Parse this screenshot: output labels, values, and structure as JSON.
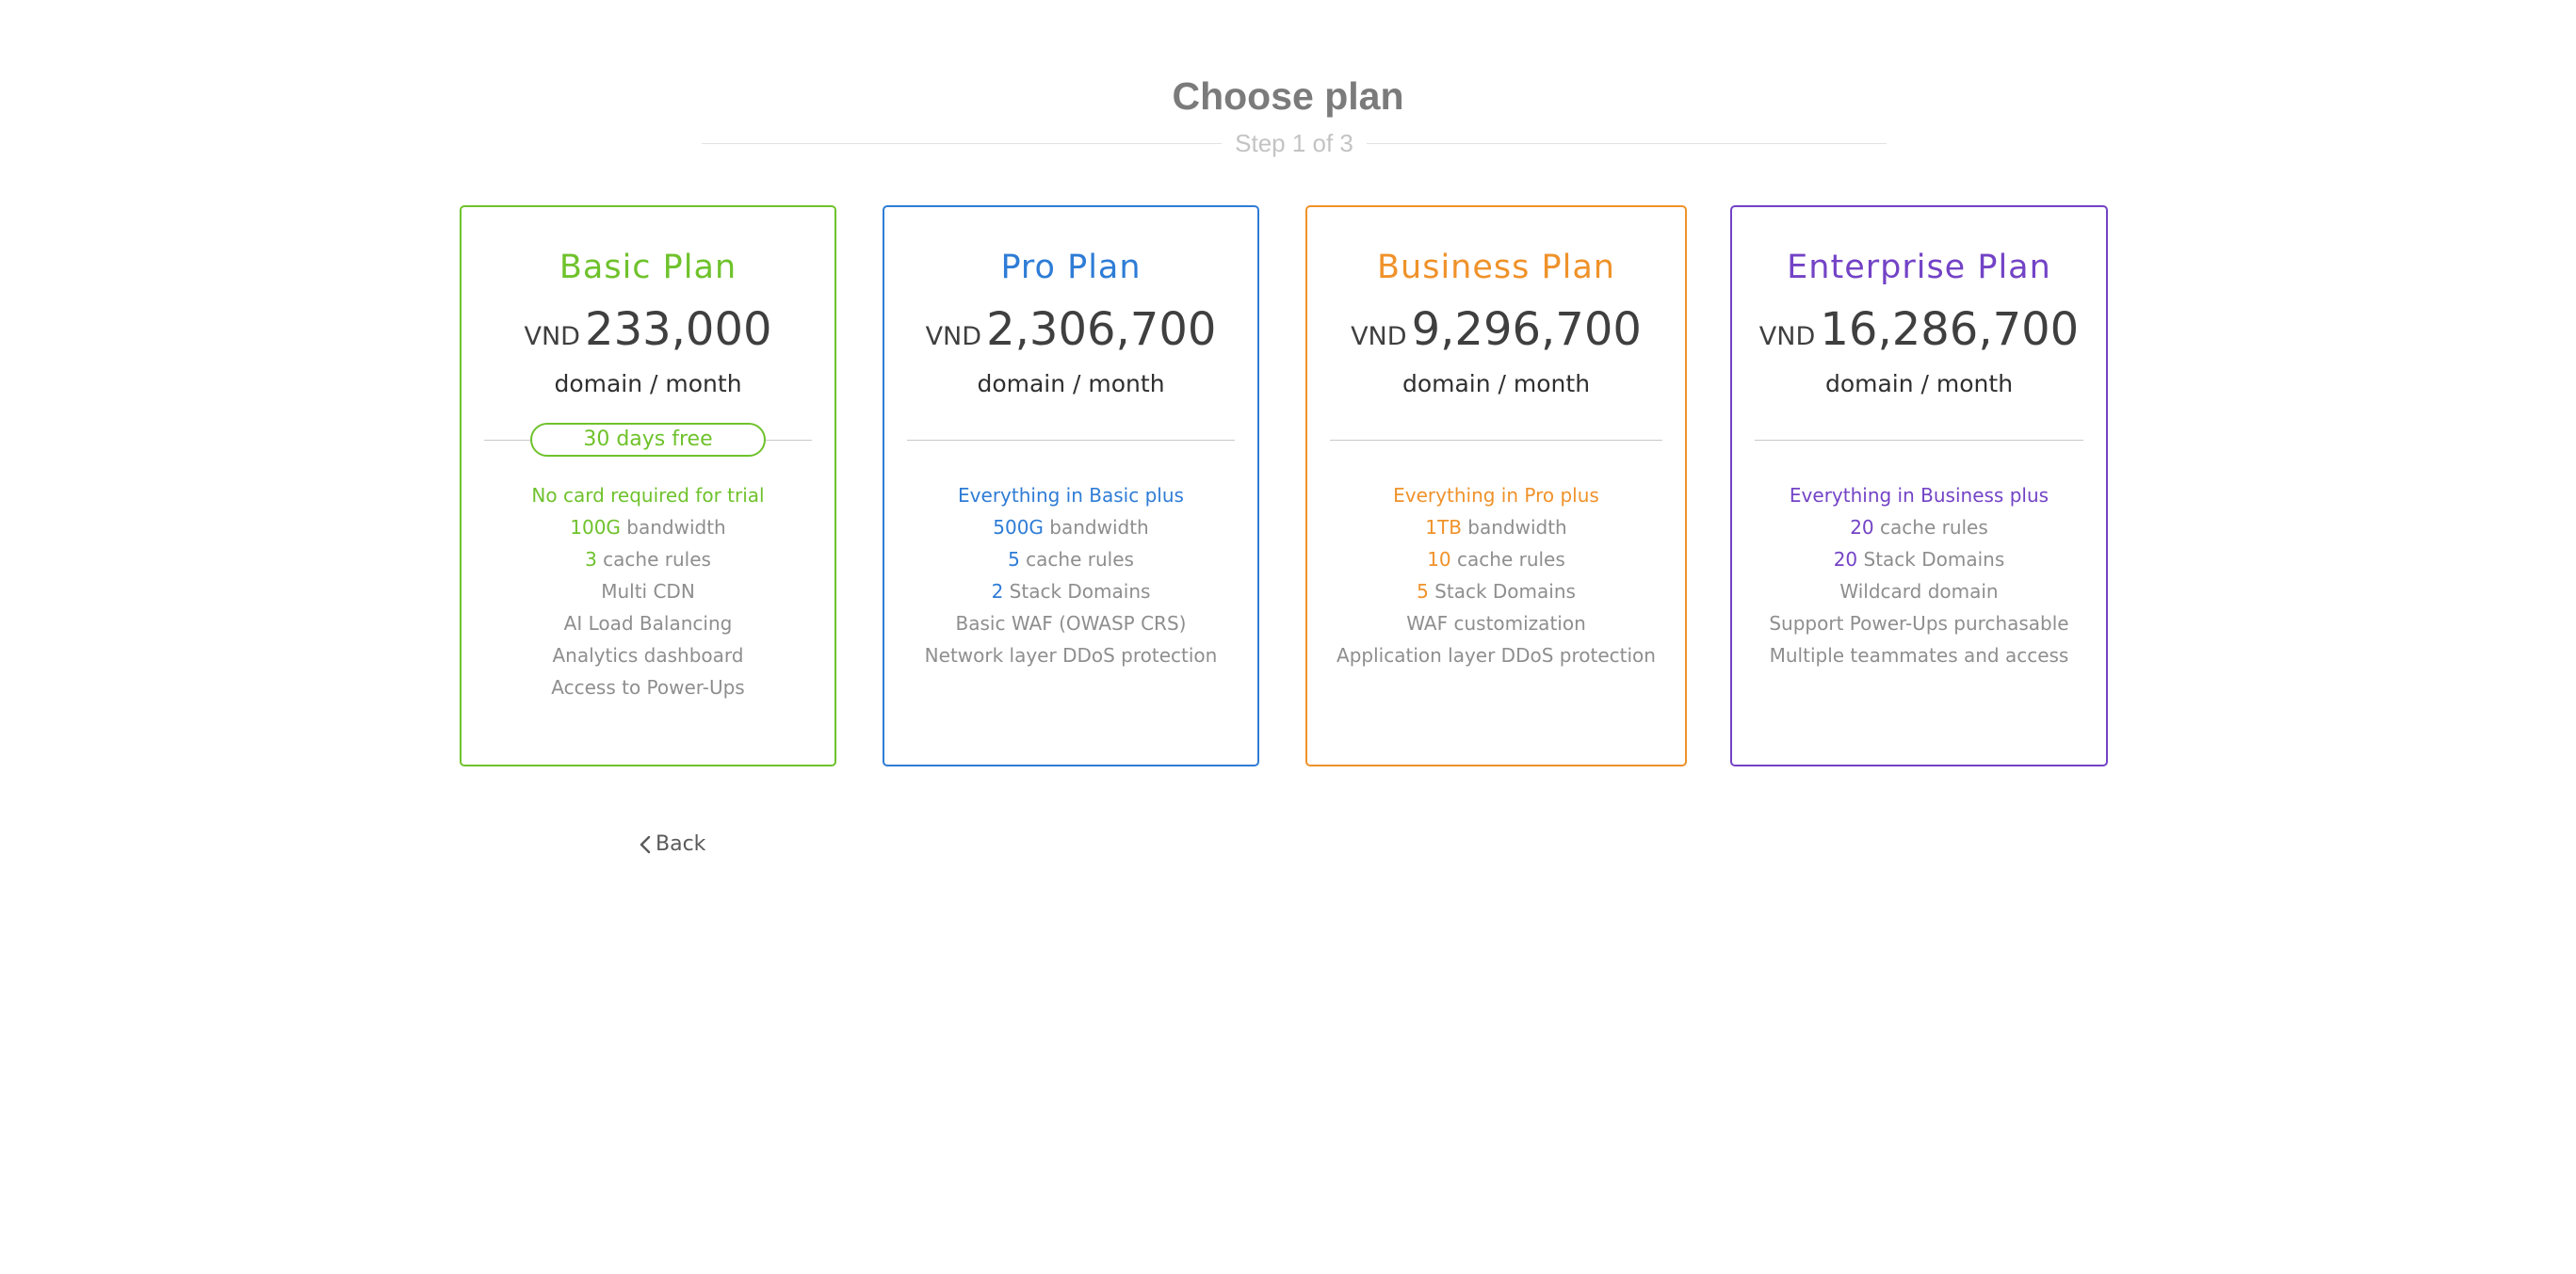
{
  "header": {
    "title": "Choose plan",
    "step": "Step 1 of 3"
  },
  "plans": [
    {
      "name": "Basic Plan",
      "currency": "VND",
      "price": "233,000",
      "period": "domain / month",
      "color": "#6fc22c",
      "trial": "30 days free",
      "intro": "No card required for trial",
      "features": [
        {
          "highlight": "100G",
          "text": " bandwidth"
        },
        {
          "highlight": "3",
          "text": " cache rules"
        },
        {
          "highlight": "",
          "text": "Multi CDN"
        },
        {
          "highlight": "",
          "text": "AI Load Balancing"
        },
        {
          "highlight": "",
          "text": "Analytics dashboard"
        },
        {
          "highlight": "",
          "text": "Access to Power-Ups"
        }
      ]
    },
    {
      "name": "Pro Plan",
      "currency": "VND",
      "price": "2,306,700",
      "period": "domain / month",
      "color": "#2e7cd6",
      "trial": "",
      "intro": "Everything in Basic plus",
      "features": [
        {
          "highlight": "500G",
          "text": " bandwidth"
        },
        {
          "highlight": "5",
          "text": " cache rules"
        },
        {
          "highlight": "2",
          "text": " Stack Domains"
        },
        {
          "highlight": "",
          "text": "Basic WAF (OWASP CRS)"
        },
        {
          "highlight": "",
          "text": "Network layer DDoS protection"
        }
      ]
    },
    {
      "name": "Business Plan",
      "currency": "VND",
      "price": "9,296,700",
      "period": "domain / month",
      "color": "#ef922a",
      "trial": "",
      "intro": "Everything in Pro plus",
      "features": [
        {
          "highlight": "1TB",
          "text": " bandwidth"
        },
        {
          "highlight": "10",
          "text": " cache rules"
        },
        {
          "highlight": "5",
          "text": " Stack Domains"
        },
        {
          "highlight": "",
          "text": "WAF customization"
        },
        {
          "highlight": "",
          "text": "Application layer DDoS protection"
        }
      ]
    },
    {
      "name": "Enterprise Plan",
      "currency": "VND",
      "price": "16,286,700",
      "period": "domain / month",
      "color": "#7343c6",
      "trial": "",
      "intro": "Everything in Business plus",
      "features": [
        {
          "highlight": "20",
          "text": " cache rules"
        },
        {
          "highlight": "20",
          "text": " Stack Domains"
        },
        {
          "highlight": "",
          "text": "Wildcard domain"
        },
        {
          "highlight": "",
          "text": "Support Power-Ups purchasable"
        },
        {
          "highlight": "",
          "text": "Multiple teammates and access"
        }
      ]
    }
  ],
  "back_label": "Back",
  "icons": {
    "back": "chevron-left-icon"
  }
}
